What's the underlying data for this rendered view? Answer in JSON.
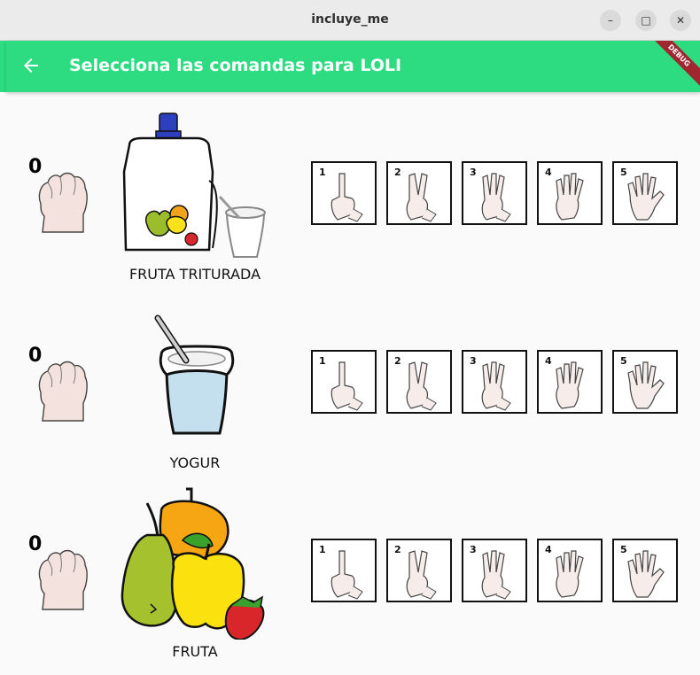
{
  "window": {
    "title": "incluye_me",
    "controls": [
      "minimize",
      "maximize",
      "close"
    ]
  },
  "appbar": {
    "title": "Selecciona las comandas para LOLI",
    "back_icon": "arrow-back-icon",
    "debug_banner": "DEBUG",
    "color": "#2ddb80"
  },
  "rows": [
    {
      "count": "0",
      "food": "FRUTA TRITURADA",
      "numbers": [
        "1",
        "2",
        "3",
        "4",
        "5"
      ]
    },
    {
      "count": "0",
      "food": "YOGUR",
      "numbers": [
        "1",
        "2",
        "3",
        "4",
        "5"
      ]
    },
    {
      "count": "0",
      "food": "FRUTA",
      "numbers": [
        "1",
        "2",
        "3",
        "4",
        "5"
      ]
    }
  ]
}
